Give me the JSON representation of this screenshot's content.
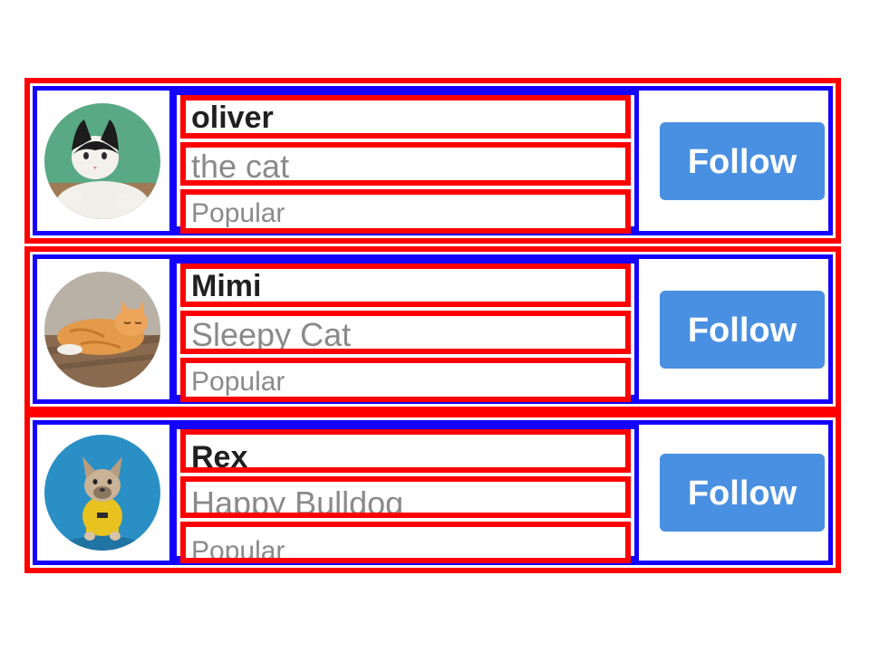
{
  "users": [
    {
      "name": "oliver",
      "subtitle": "the cat",
      "tag": "Popular",
      "button_label": "Follow",
      "avatar_icon": "cat-tuxedo-avatar"
    },
    {
      "name": "Mimi",
      "subtitle": "Sleepy Cat",
      "tag": "Popular",
      "button_label": "Follow",
      "avatar_icon": "cat-orange-sleeping-avatar"
    },
    {
      "name": "Rex",
      "subtitle": "Happy Bulldog",
      "tag": "Popular",
      "button_label": "Follow",
      "avatar_icon": "french-bulldog-avatar"
    }
  ],
  "colors": {
    "outer_border": "#ff0000",
    "inner_border": "#1400ff",
    "button_bg": "#4a90e2",
    "name_text": "#202020",
    "muted_text": "#8a8a8a"
  }
}
